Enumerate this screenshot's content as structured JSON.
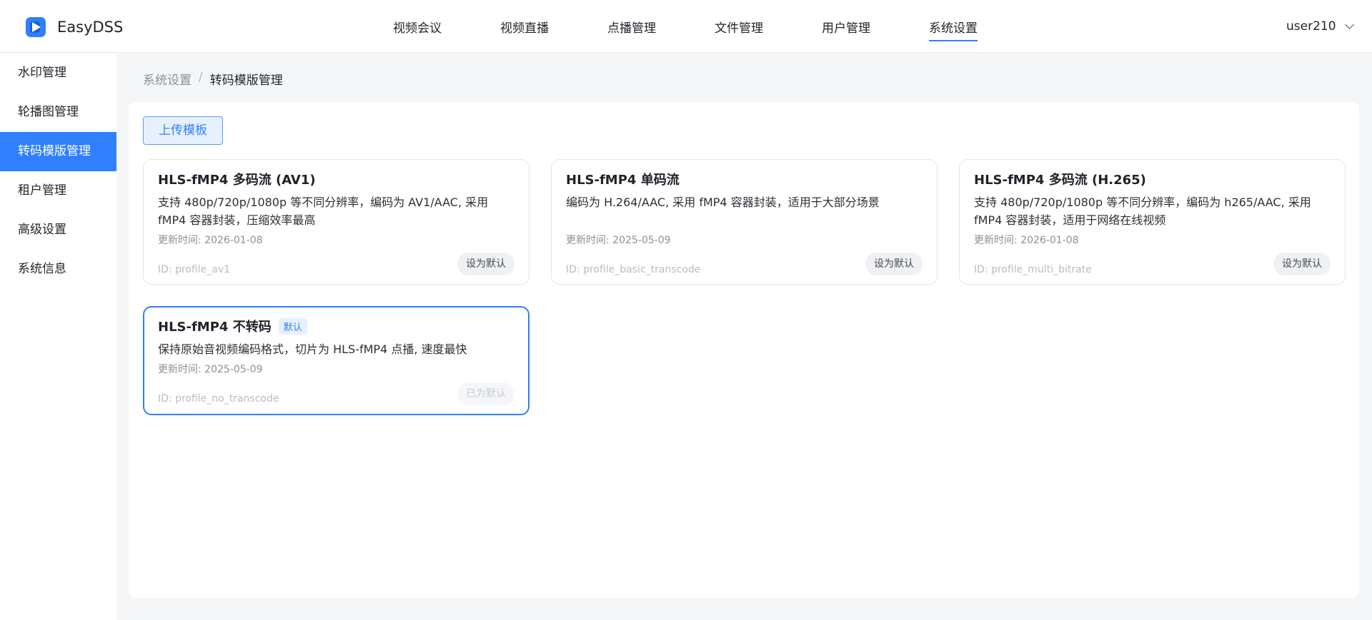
{
  "header": {
    "app_name": "EasyDSS",
    "nav": [
      {
        "label": "视频会议"
      },
      {
        "label": "视频直播"
      },
      {
        "label": "点播管理"
      },
      {
        "label": "文件管理"
      },
      {
        "label": "用户管理"
      },
      {
        "label": "系统设置"
      }
    ],
    "active_nav": "系统设置",
    "user": "user210"
  },
  "sidebar": {
    "items": [
      {
        "label": "水印管理"
      },
      {
        "label": "轮播图管理"
      },
      {
        "label": "转码模版管理"
      },
      {
        "label": "租户管理"
      },
      {
        "label": "高级设置"
      },
      {
        "label": "系统信息"
      }
    ],
    "active": "转码模版管理"
  },
  "breadcrumb": {
    "parent": "系统设置",
    "separator": "/",
    "current": "转码模版管理"
  },
  "toolbar": {
    "upload_label": "上传模板"
  },
  "cards": [
    {
      "title": "HLS-fMP4 多码流 (AV1)",
      "description": "支持 480p/720p/1080p 等不同分辨率，编码为 AV1/AAC, 采用 fMP4 容器封装，压缩效率最高",
      "updated": "更新时间: 2026-01-08",
      "id": "ID: profile_av1",
      "button": "设为默认"
    },
    {
      "title": "HLS-fMP4 单码流",
      "description": "编码为 H.264/AAC, 采用 fMP4 容器封装，适用于大部分场景",
      "updated": "更新时间: 2025-05-09",
      "id": "ID: profile_basic_transcode",
      "button": "设为默认"
    },
    {
      "title": "HLS-fMP4 多码流 (H.265)",
      "description": "支持 480p/720p/1080p 等不同分辨率，编码为 h265/AAC, 采用 fMP4 容器封装，适用于网络在线视频",
      "updated": "更新时间: 2026-01-08",
      "id": "ID: profile_multi_bitrate",
      "button": "设为默认"
    },
    {
      "title": "HLS-fMP4 不转码",
      "badge": "默认",
      "description": "保持原始音视频编码格式，切片为 HLS-fMP4 点播, 速度最快",
      "updated": "更新时间: 2025-05-09",
      "id": "ID: profile_no_transcode",
      "button": "已为默认"
    }
  ],
  "colors": {
    "accent": "#2f7fff",
    "badge_bg": "#e6f0ff"
  }
}
